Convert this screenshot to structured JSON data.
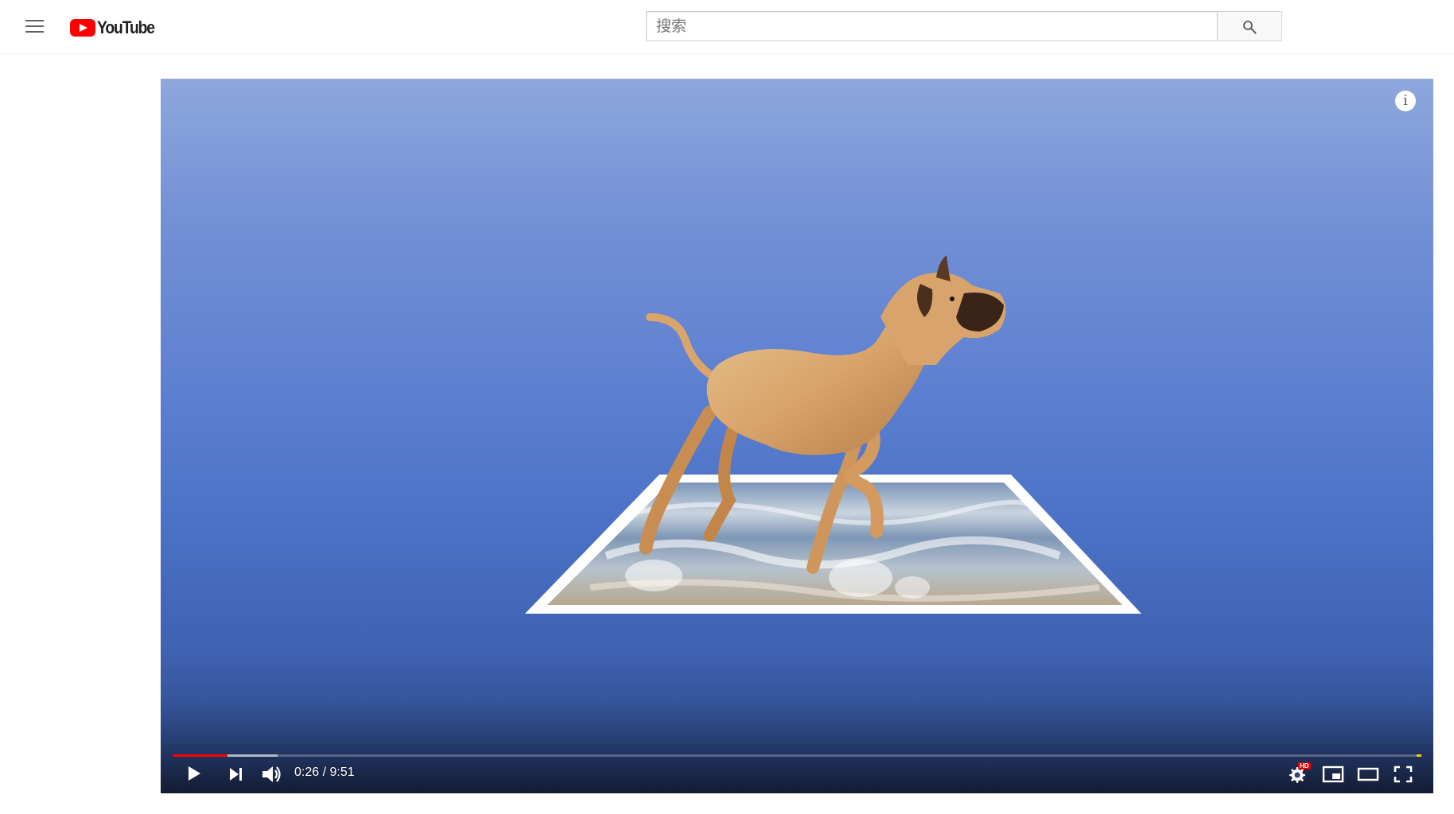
{
  "masthead": {
    "logo_text": "YouTube",
    "search_placeholder": "搜索"
  },
  "player": {
    "current_time": "0:26",
    "duration": "9:51",
    "time_display": "0:26 / 9:51",
    "progress_fraction": 0.044,
    "buffered_fraction": 0.084,
    "quality_badge": "HD",
    "info_glyph": "i"
  },
  "icons": {
    "menu": "hamburger-menu-icon",
    "search": "search-icon",
    "info": "info-icon",
    "play": "play-icon",
    "next": "next-icon",
    "volume": "volume-icon",
    "settings": "gear-icon",
    "miniplayer": "miniplayer-icon",
    "theater": "theater-mode-icon",
    "fullscreen": "fullscreen-icon"
  },
  "colors": {
    "brand_red": "#ff0000",
    "progress_played": "#ff0000",
    "ad_marker": "#ffcc00"
  }
}
